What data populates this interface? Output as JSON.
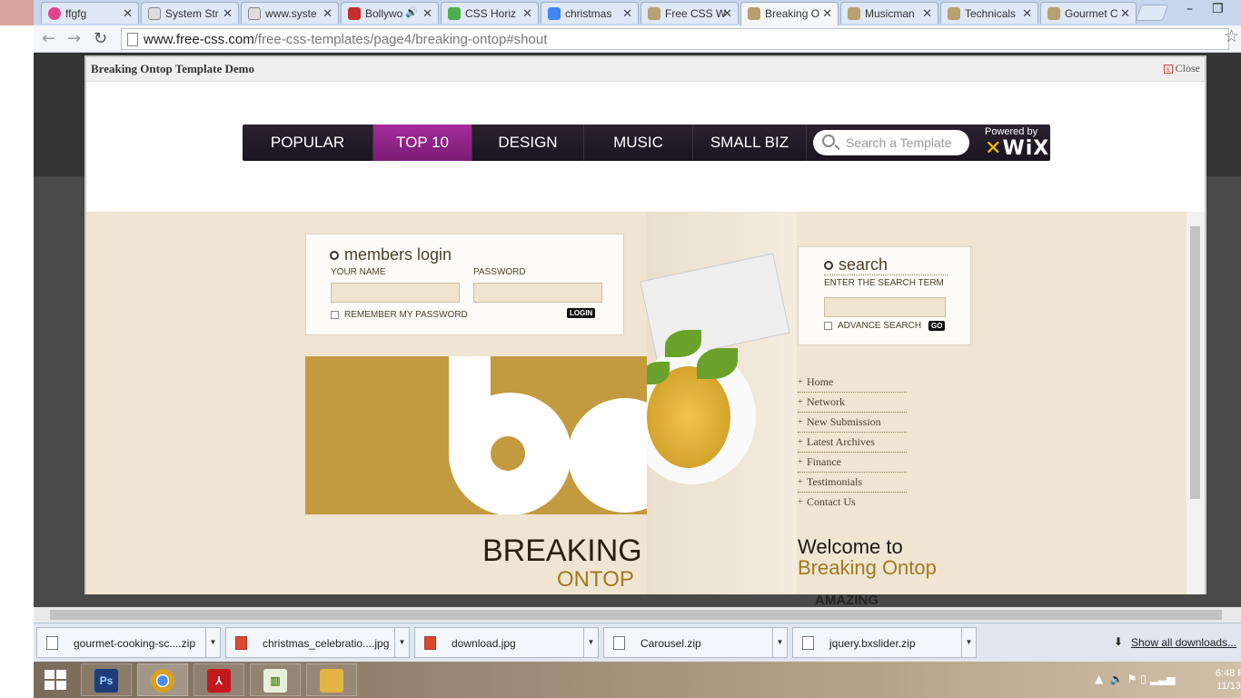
{
  "browser": {
    "tabs": [
      {
        "label": "ffgfg",
        "color": "#e0458e"
      },
      {
        "label": "System Str",
        "color": "#7a7a7a"
      },
      {
        "label": "www.syste",
        "color": "#7a7a7a"
      },
      {
        "label": "Bollywo",
        "color": "#c4302b"
      },
      {
        "label": "CSS Horiz",
        "color": "#4caf50"
      },
      {
        "label": "christmas",
        "color": "#4285f4"
      },
      {
        "label": "Free CSS W",
        "color": "#b8a070"
      },
      {
        "label": "Breaking O",
        "color": "#b8a070"
      },
      {
        "label": "Musicman",
        "color": "#b8a070"
      },
      {
        "label": "Technicals",
        "color": "#b8a070"
      },
      {
        "label": "Gourmet C",
        "color": "#b8a070"
      }
    ],
    "url_host": "www.free-css.com",
    "url_path": "/free-css-templates/page4/breaking-ontop#shout"
  },
  "modal": {
    "title": "Breaking Ontop Template Demo",
    "close_label": "Close"
  },
  "wixbar": {
    "items": [
      "POPULAR",
      "TOP 10",
      "DESIGN",
      "MUSIC",
      "SMALL BIZ"
    ],
    "search_placeholder": "Search a Template",
    "powered_by": "Powered by",
    "wix_logo": "WiX"
  },
  "template": {
    "login": {
      "title": "members login",
      "name_label": "YOUR NAME",
      "password_label": "PASSWORD",
      "remember_label": "REMEMBER MY PASSWORD",
      "login_button": "LOGIN"
    },
    "search": {
      "title": "search",
      "term_label": "ENTER THE SEARCH TERM",
      "advance_label": "ADVANCE SEARCH",
      "go_button": "GO"
    },
    "menu": [
      "Home",
      "Network",
      "New Submission",
      "Latest Archives",
      "Finance",
      "Testimonials",
      "Contact Us"
    ],
    "brand_big": "BREAKING",
    "brand_small": "ONTOP",
    "welcome_line1": "Welcome to",
    "welcome_line2": "Breaking Ontop",
    "under_text": "AMAZING"
  },
  "downloads": {
    "items": [
      {
        "label": "gourmet-cooking-sc....zip",
        "type": "zip"
      },
      {
        "label": "christmas_celebratio....jpg",
        "type": "image"
      },
      {
        "label": "download.jpg",
        "type": "image"
      },
      {
        "label": "Carousel.zip",
        "type": "zip"
      },
      {
        "label": "jquery.bxslider.zip",
        "type": "zip"
      }
    ],
    "show_all": "Show all downloads..."
  },
  "taskbar": {
    "apps": [
      {
        "name": "photoshop",
        "label": "Ps",
        "color": "#1c3d7a"
      },
      {
        "name": "chrome",
        "label": "",
        "color": "#d8a024"
      },
      {
        "name": "acrobat",
        "label": "",
        "color": "#c4181f"
      },
      {
        "name": "chart-app",
        "label": "",
        "color": "#5a8f2a"
      },
      {
        "name": "file-explorer",
        "label": "",
        "color": "#e1b444"
      }
    ],
    "clock_time": "6:48 F",
    "clock_date": "11/13/"
  }
}
